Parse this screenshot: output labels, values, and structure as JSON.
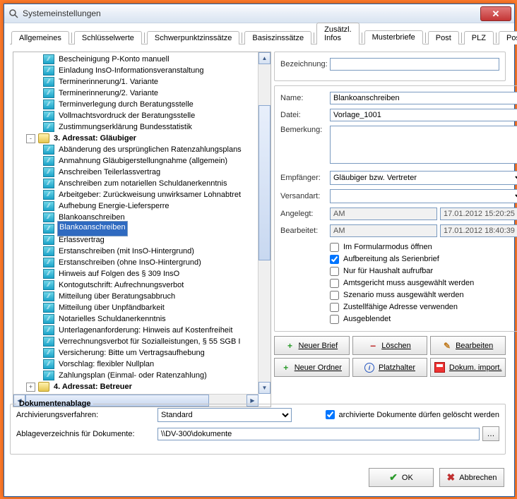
{
  "window": {
    "title": "Systemeinstellungen"
  },
  "tabs": [
    "Allgemeines",
    "Schlüsselwerte",
    "Schwerpunktzinssätze",
    "Basiszinssätze",
    "Zusätzl. Infos",
    "Musterbriefe",
    "Post",
    "PLZ",
    "Postausgang"
  ],
  "active_tab": 5,
  "tree": {
    "items": [
      {
        "indent": 40,
        "kind": "leaf",
        "label": "Bescheinigung P-Konto manuell"
      },
      {
        "indent": 40,
        "kind": "leaf",
        "label": "Einladung InsO-Informationsveranstaltung"
      },
      {
        "indent": 40,
        "kind": "leaf",
        "label": "Terminerinnerung/1. Variante"
      },
      {
        "indent": 40,
        "kind": "leaf",
        "label": "Terminerinnerung/2. Variante"
      },
      {
        "indent": 40,
        "kind": "leaf",
        "label": "Terminverlegung durch Beratungsstelle"
      },
      {
        "indent": 40,
        "kind": "leaf",
        "label": "Vollmachtsvordruck der Beratungsstelle"
      },
      {
        "indent": 40,
        "kind": "leaf",
        "label": "Zustimmungserklärung Bundesstatistik"
      },
      {
        "indent": 16,
        "kind": "folder",
        "toggle": "-",
        "label": "3. Adressat: Gläubiger",
        "bold": true
      },
      {
        "indent": 40,
        "kind": "leaf",
        "label": "Abänderung des ursprünglichen Ratenzahlungsplans"
      },
      {
        "indent": 40,
        "kind": "leaf",
        "label": "Anmahnung Gläubigerstellungnahme (allgemein)"
      },
      {
        "indent": 40,
        "kind": "leaf",
        "label": "Anschreiben Teilerlassvertrag"
      },
      {
        "indent": 40,
        "kind": "leaf",
        "label": "Anschreiben zum notariellen Schuldanerkenntnis"
      },
      {
        "indent": 40,
        "kind": "leaf",
        "label": "Arbeitgeber: Zurückweisung unwirksamer Lohnabtret"
      },
      {
        "indent": 40,
        "kind": "leaf",
        "label": "Aufhebung Energie-Liefersperre"
      },
      {
        "indent": 40,
        "kind": "leaf",
        "label": "Blankoanschreiben"
      },
      {
        "indent": 40,
        "kind": "leaf",
        "label": "Blankoanschreiben",
        "selected": true
      },
      {
        "indent": 40,
        "kind": "leaf",
        "label": "Erlassvertrag"
      },
      {
        "indent": 40,
        "kind": "leaf",
        "label": "Erstanschreiben (mit InsO-Hintergrund)"
      },
      {
        "indent": 40,
        "kind": "leaf",
        "label": "Erstanschreiben (ohne InsO-Hintergrund)"
      },
      {
        "indent": 40,
        "kind": "leaf",
        "label": "Hinweis auf Folgen des § 309 InsO"
      },
      {
        "indent": 40,
        "kind": "leaf",
        "label": "Kontogutschrift: Aufrechnungsverbot"
      },
      {
        "indent": 40,
        "kind": "leaf",
        "label": "Mitteilung über Beratungsabbruch"
      },
      {
        "indent": 40,
        "kind": "leaf",
        "label": "Mitteilung über Unpfändbarkeit"
      },
      {
        "indent": 40,
        "kind": "leaf",
        "label": "Notarielles Schuldanerkenntnis"
      },
      {
        "indent": 40,
        "kind": "leaf",
        "label": "Unterlagenanforderung: Hinweis auf Kostenfreiheit"
      },
      {
        "indent": 40,
        "kind": "leaf",
        "label": "Verrechnungsverbot für Sozialleistungen, § 55 SGB I"
      },
      {
        "indent": 40,
        "kind": "leaf",
        "label": "Versicherung: Bitte um Vertragsaufhebung"
      },
      {
        "indent": 40,
        "kind": "leaf",
        "label": "Vorschlag: flexibler Nullplan"
      },
      {
        "indent": 40,
        "kind": "leaf",
        "label": "Zahlungsplan (Einmal- oder Ratenzahlung)"
      },
      {
        "indent": 16,
        "kind": "folder",
        "toggle": "+",
        "label": "4. Adressat: Betreuer",
        "bold": true
      }
    ]
  },
  "detail": {
    "bezeichnung_label": "Bezeichnung:",
    "bezeichnung": "",
    "name_label": "Name:",
    "name": "Blankoanschreiben",
    "datei_label": "Datei:",
    "datei": "Vorlage_1001",
    "bemerkung_label": "Bemerkung:",
    "bemerkung": "",
    "empfaenger_label": "Empfänger:",
    "empfaenger": "Gläubiger bzw. Vertreter",
    "versandart_label": "Versandart:",
    "versandart": "",
    "angelegt_label": "Angelegt:",
    "angelegt_user": "AM",
    "angelegt_ts": "17.01.2012 15:20:25",
    "bearbeitet_label": "Bearbeitet:",
    "bearbeitet_user": "AM",
    "bearbeitet_ts": "17.01.2012 18:40:39",
    "checks": [
      {
        "label": "Im Formularmodus öffnen",
        "checked": false
      },
      {
        "label": "Aufbereitung als Serienbrief",
        "checked": true
      },
      {
        "label": "Nur für Haushalt aufrufbar",
        "checked": false
      },
      {
        "label": "Amtsgericht muss ausgewählt werden",
        "checked": false
      },
      {
        "label": "Szenario muss ausgewählt werden",
        "checked": false
      },
      {
        "label": "Zustellfähige Adresse verwenden",
        "checked": false
      },
      {
        "label": "Ausgeblendet",
        "checked": false
      }
    ]
  },
  "buttons": {
    "neuer_brief": "Neuer Brief",
    "loeschen": "Löschen",
    "bearbeiten": "Bearbeiten",
    "neuer_ordner": "Neuer Ordner",
    "platzhalter": "Platzhalter",
    "dokum_import": "Dokum. import."
  },
  "docstore": {
    "legend": "Dokumentenablage",
    "arch_label": "Archivierungsverfahren:",
    "arch_value": "Standard",
    "del_label": "archivierte Dokumente dürfen gelöscht werden",
    "del_checked": true,
    "path_label": "Ablageverzeichnis für Dokumente:",
    "path_value": "\\\\DV-300\\dokumente"
  },
  "dialog": {
    "ok": "OK",
    "cancel": "Abbrechen"
  }
}
